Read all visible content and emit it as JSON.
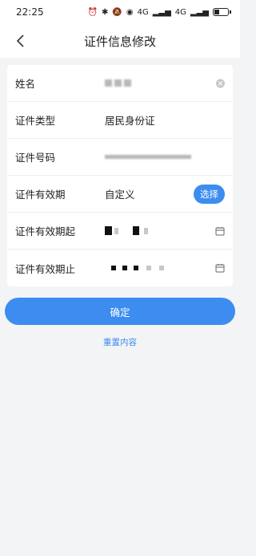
{
  "status_bar": {
    "time": "22:25",
    "network_1": "4G",
    "network_2": "4G"
  },
  "nav": {
    "title": "证件信息修改",
    "back_icon": "chevron-left-icon"
  },
  "form": {
    "rows": [
      {
        "label": "姓名",
        "value": "",
        "action": "clear"
      },
      {
        "label": "证件类型",
        "value": "居民身份证"
      },
      {
        "label": "证件号码",
        "value": ""
      },
      {
        "label": "证件有效期",
        "value": "自定义",
        "action_label": "选择"
      },
      {
        "label": "证件有效期起",
        "value": "",
        "action": "calendar"
      },
      {
        "label": "证件有效期止",
        "value": "",
        "action": "calendar"
      }
    ]
  },
  "buttons": {
    "confirm": "确定",
    "reset": "重置内容"
  },
  "colors": {
    "accent": "#3d8cf0",
    "background": "#f3f4f6"
  }
}
